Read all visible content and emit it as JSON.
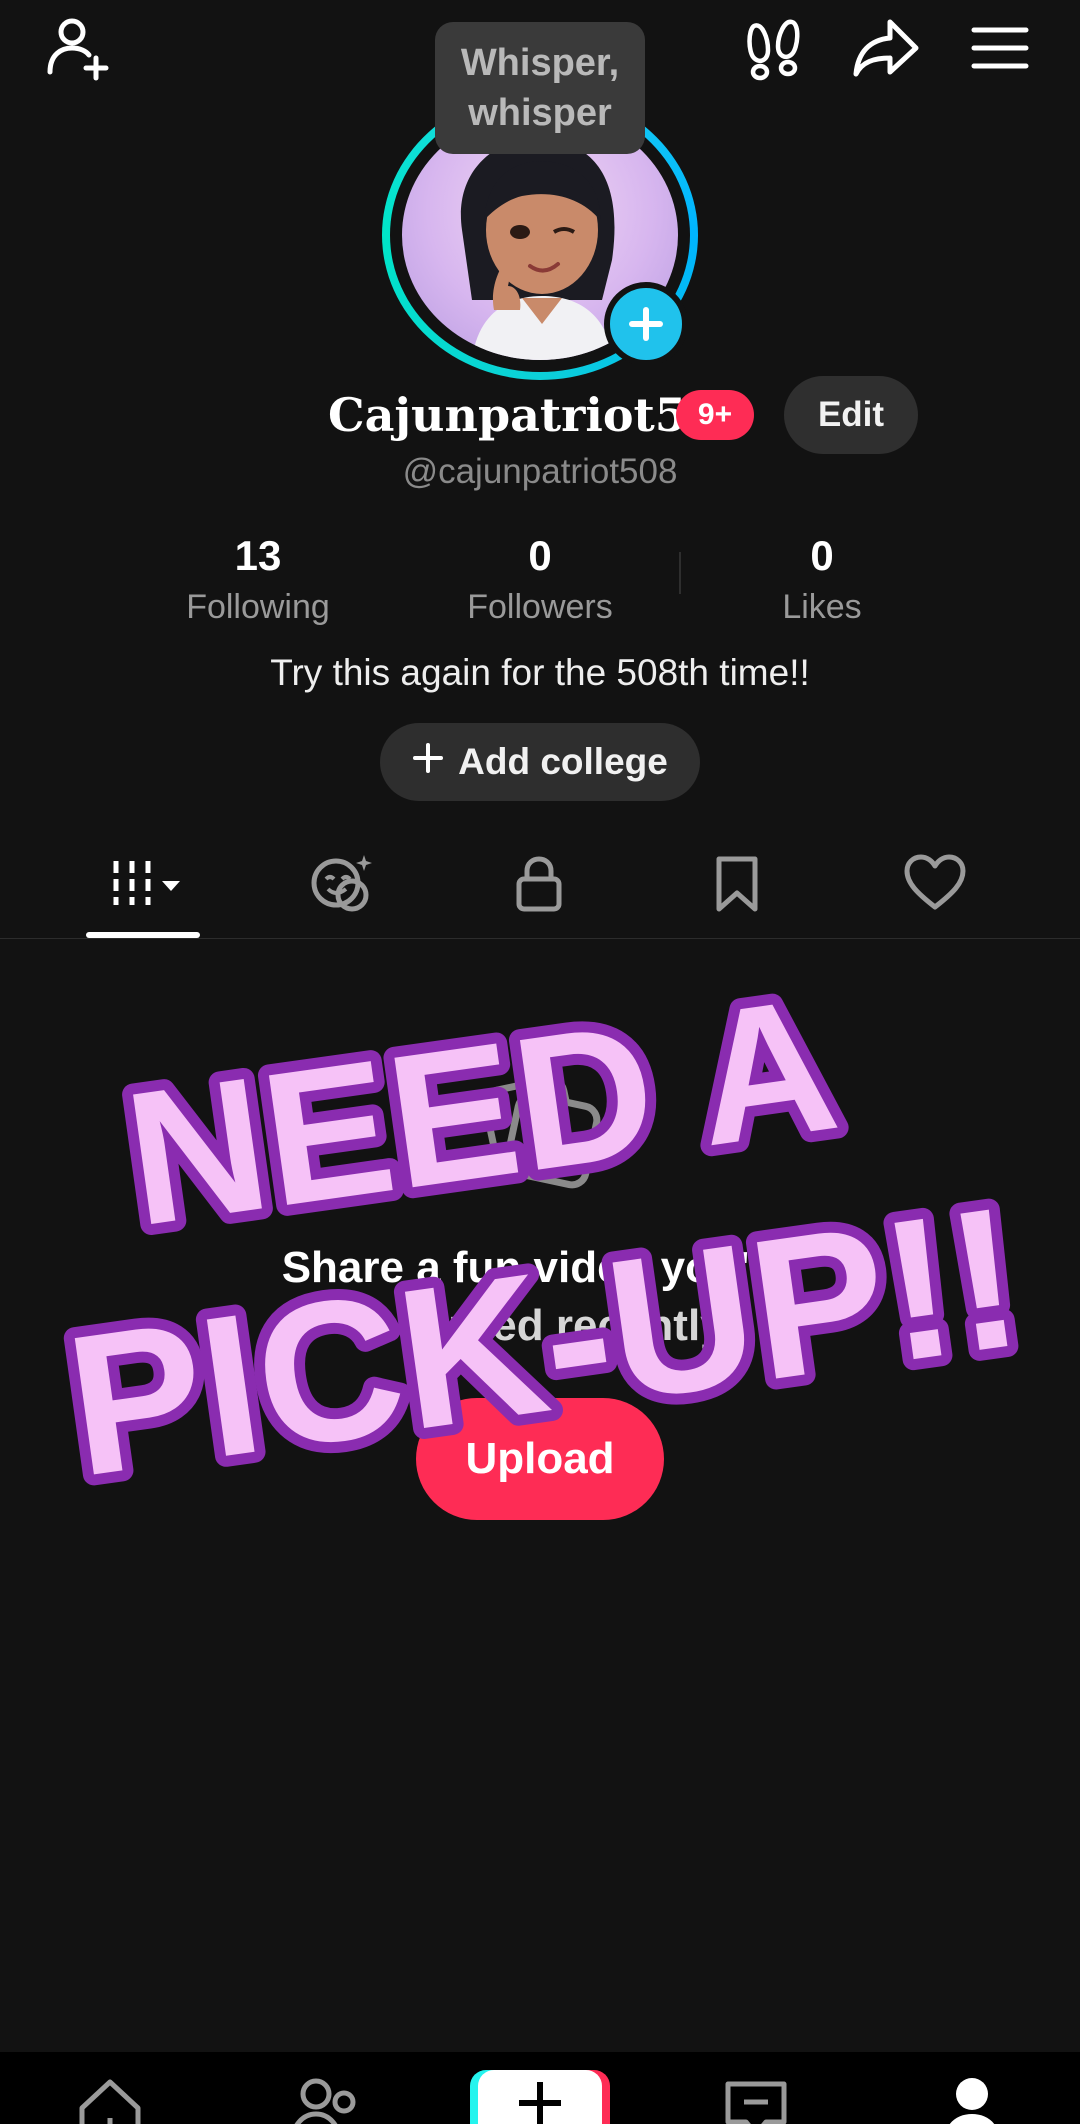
{
  "header": {
    "tooltip_text": "Whisper, whisper"
  },
  "profile": {
    "display_name": "Cajunpatriot508",
    "notification_badge": "9+",
    "edit_label": "Edit",
    "handle": "@cajunpatriot508",
    "stats": [
      {
        "value": "13",
        "label": "Following"
      },
      {
        "value": "0",
        "label": "Followers"
      },
      {
        "value": "0",
        "label": "Likes"
      }
    ],
    "bio": "Try this again for the 508th time!!",
    "add_college_label": "Add college"
  },
  "tabs": [
    {
      "icon": "videos-grid-icon",
      "active": true
    },
    {
      "icon": "reposts-icon",
      "active": false
    },
    {
      "icon": "lock-icon",
      "active": false
    },
    {
      "icon": "bookmark-icon",
      "active": false
    },
    {
      "icon": "heart-icon",
      "active": false
    }
  ],
  "empty_state": {
    "title": "Share a fun video you've",
    "subtitle": "recorded recently",
    "upload_label": "Upload"
  },
  "overlay": {
    "line1": "NEED A",
    "line2": "PICK-UP!!",
    "fill_color": "#f6c2f7",
    "stroke_color": "#8a2cb0"
  },
  "bottom_nav": {
    "items": [
      "home-icon",
      "friends-icon",
      "create-icon",
      "inbox-icon",
      "profile-icon"
    ]
  },
  "colors": {
    "accent": "#fe2c55",
    "ring": "#20d5ec",
    "background": "#121212"
  }
}
